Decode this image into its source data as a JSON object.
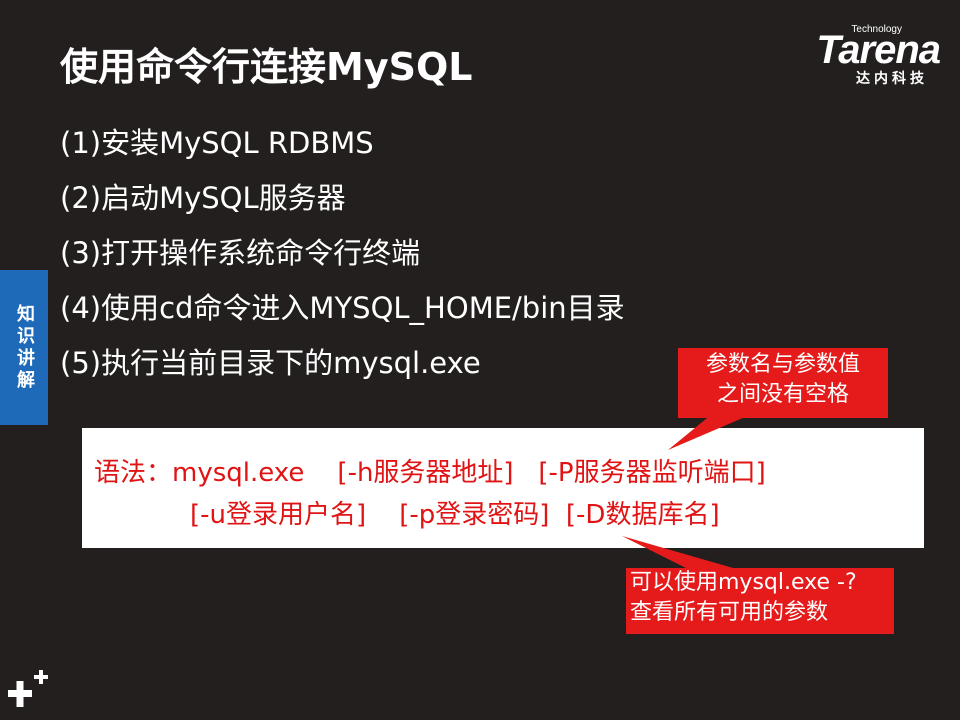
{
  "slide": {
    "title": "使用命令行连接MySQL",
    "side_tab": "知识讲解",
    "steps": [
      "(1)安装MySQL RDBMS",
      "(2)启动MySQL服务器",
      "(3)打开操作系统命令行终端",
      "(4)使用cd命令进入MYSQL_HOME/bin目录",
      "(5)执行当前目录下的mysql.exe"
    ],
    "syntax": {
      "line1": "语法：mysql.exe    [-h服务器地址]   [-P服务器监听端口]",
      "line2": "[-u登录用户名]    [-p登录密码]  [-D数据库名]"
    },
    "callout_top": [
      "参数名与参数值",
      "之间没有空格"
    ],
    "callout_bottom": [
      "可以使用mysql.exe -?",
      "查看所有可用的参数"
    ]
  },
  "logo": {
    "word": "Tarena",
    "tagline": "Technology",
    "cn": "达内科技"
  },
  "colors": {
    "background": "#231f1e",
    "accent_red": "#e51b1b",
    "tab_blue": "#1f6ab8",
    "text": "#ffffff"
  }
}
